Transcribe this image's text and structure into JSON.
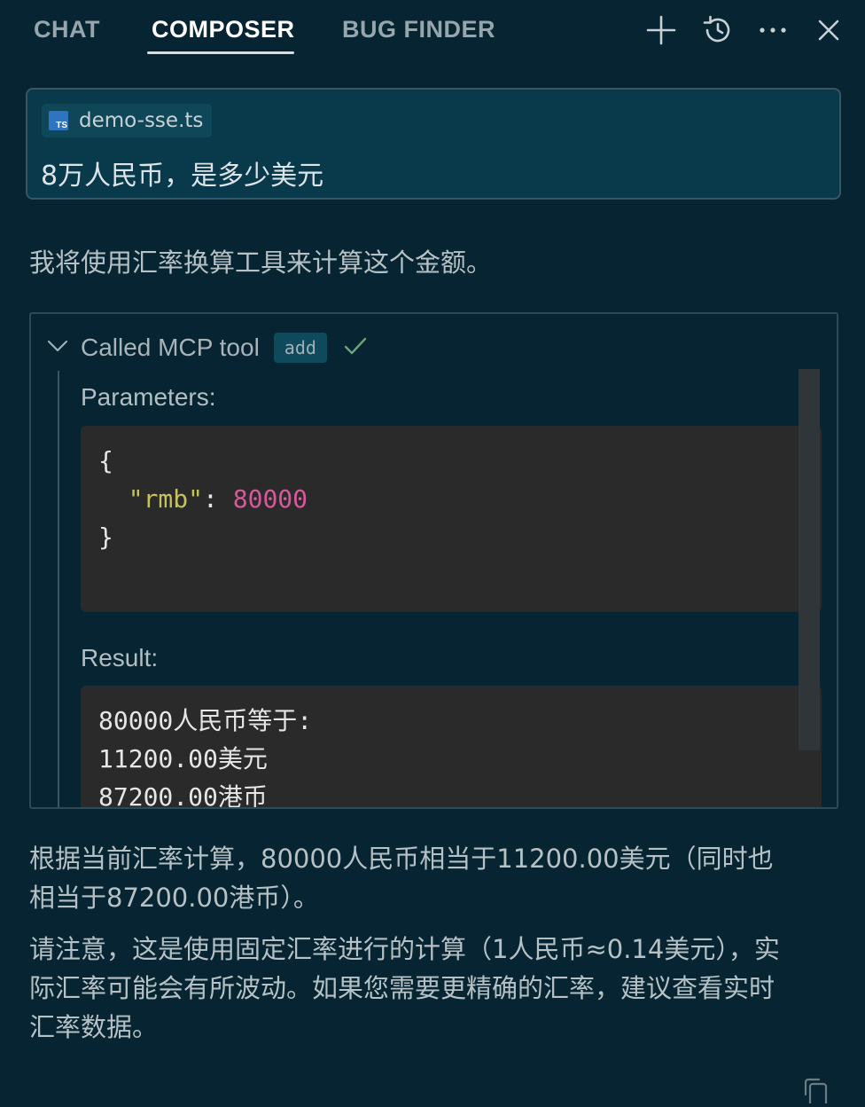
{
  "header": {
    "tabs": [
      {
        "label": "CHAT",
        "active": false
      },
      {
        "label": "COMPOSER",
        "active": true
      },
      {
        "label": "BUG FINDER",
        "active": false
      }
    ],
    "icons": [
      "plus-icon",
      "history-icon",
      "more-icon",
      "close-icon"
    ]
  },
  "prompt": {
    "file_chip": {
      "label": "demo-sse.ts",
      "icon": "typescript-file-icon",
      "icon_text": "TS"
    },
    "text": "8万人民币，是多少美元"
  },
  "assistant": {
    "intro": "我将使用汇率换算工具来计算这个金额。",
    "tool_call": {
      "title": "Called MCP tool",
      "tool_name": "add",
      "status_icon": "check-icon",
      "parameters_label": "Parameters:",
      "parameters": {
        "open": "{",
        "key": "\"rmb\"",
        "colon": ": ",
        "value": "80000",
        "close": "}"
      },
      "result_label": "Result:",
      "result_lines": [
        "80000人民币等于:",
        "11200.00美元",
        "87200.00港币"
      ]
    },
    "paragraphs": [
      [
        "根据当前汇率计算，80000人民币相当于11200.00美元（同时也",
        "相当于87200.00港币）。"
      ],
      [
        "请注意，这是使用固定汇率进行的计算（1人民币≈0.14美元），实",
        "际汇率可能会有所波动。如果您需要更精确的汇率，建议查看实时",
        "汇率数据。"
      ]
    ]
  },
  "colors": {
    "background": "#062431",
    "json_key": "#c7c35c",
    "json_number": "#d9589a",
    "ts_icon": "#2f74c0"
  }
}
